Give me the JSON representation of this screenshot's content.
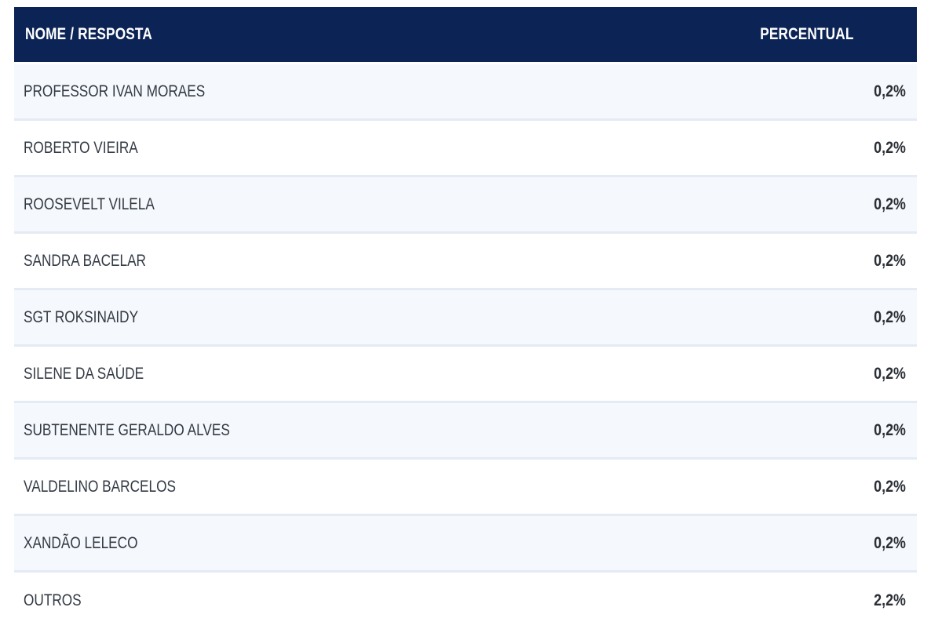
{
  "table": {
    "header": {
      "name": "NOME / RESPOSTA",
      "percent": "PERCENTUAL"
    },
    "rows": [
      {
        "name": "PROFESSOR IVAN MORAES",
        "percent": "0,2%"
      },
      {
        "name": "ROBERTO VIEIRA",
        "percent": "0,2%"
      },
      {
        "name": "ROOSEVELT VILELA",
        "percent": "0,2%"
      },
      {
        "name": "SANDRA BACELAR",
        "percent": "0,2%"
      },
      {
        "name": "SGT ROKSINAIDY",
        "percent": "0,2%"
      },
      {
        "name": "SILENE DA SAÚDE",
        "percent": "0,2%"
      },
      {
        "name": "SUBTENENTE GERALDO ALVES",
        "percent": "0,2%"
      },
      {
        "name": "VALDELINO BARCELOS",
        "percent": "0,2%"
      },
      {
        "name": "XANDÃO LELECO",
        "percent": "0,2%"
      },
      {
        "name": "OUTROS",
        "percent": "2,2%"
      }
    ]
  },
  "colors": {
    "header_bg": "#0c2455",
    "header_text": "#ffffff",
    "row_alt_bg": "#f5f8fc",
    "row_divider": "#e4ebf5"
  }
}
